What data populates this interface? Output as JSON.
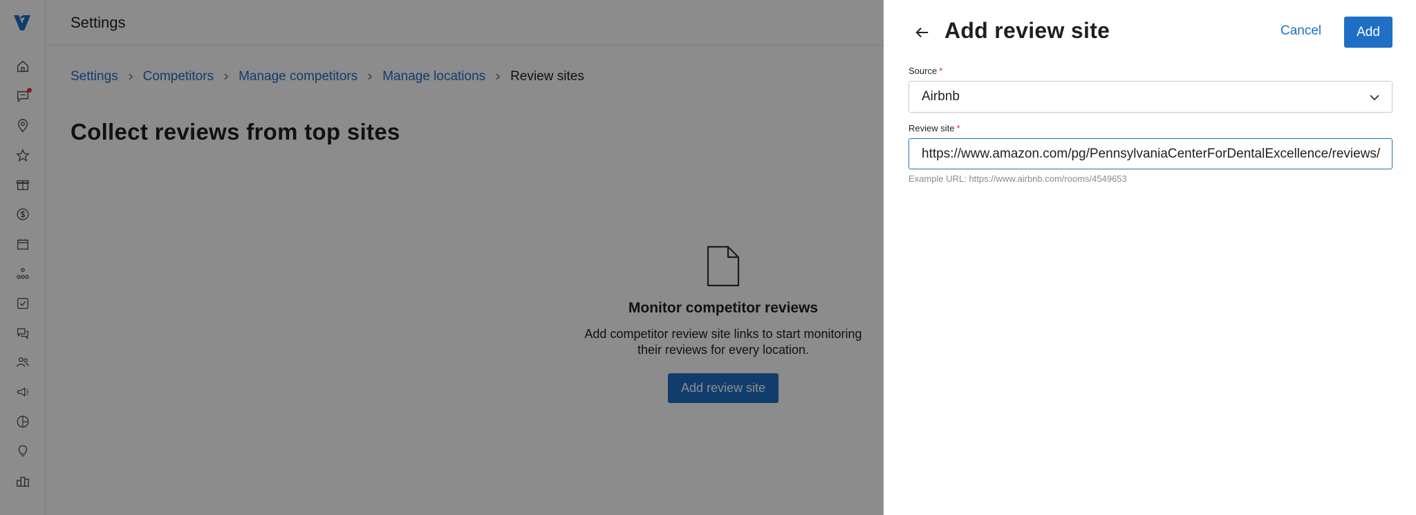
{
  "app": {
    "header_title": "Settings"
  },
  "nav": {
    "items": [
      {
        "icon": "home-icon"
      },
      {
        "icon": "messages-icon",
        "badge": true
      },
      {
        "icon": "location-pin-icon"
      },
      {
        "icon": "star-icon"
      },
      {
        "icon": "gift-icon"
      },
      {
        "icon": "dollar-icon"
      },
      {
        "icon": "calendar-icon"
      },
      {
        "icon": "network-icon"
      },
      {
        "icon": "checklist-icon"
      },
      {
        "icon": "chat-bubbles-icon"
      },
      {
        "icon": "people-icon"
      },
      {
        "icon": "megaphone-icon"
      },
      {
        "icon": "analytics-icon"
      },
      {
        "icon": "lightbulb-icon"
      },
      {
        "icon": "leaderboard-icon"
      }
    ]
  },
  "breadcrumb": {
    "items": [
      "Settings",
      "Competitors",
      "Manage competitors",
      "Manage locations",
      "Review sites"
    ]
  },
  "main": {
    "heading": "Collect reviews from top sites",
    "empty_title": "Monitor competitor reviews",
    "empty_desc_line1": "Add competitor review site links to start monitoring",
    "empty_desc_line2": "their reviews for every location.",
    "add_button_label": "Add review site"
  },
  "panel": {
    "title": "Add review site",
    "cancel_label": "Cancel",
    "add_label": "Add",
    "source_label": "Source",
    "source_required": "*",
    "source_value": "Airbnb",
    "review_site_label": "Review site",
    "review_site_required": "*",
    "review_site_value": "https://www.amazon.com/pg/PennsylvaniaCenterForDentalExcellence/reviews/",
    "hint": "Example URL: https://www.airbnb.com/rooms/4549653"
  },
  "colors": {
    "accent": "#1e6fc5",
    "required": "#d92d20",
    "badge": "#e5383b"
  }
}
